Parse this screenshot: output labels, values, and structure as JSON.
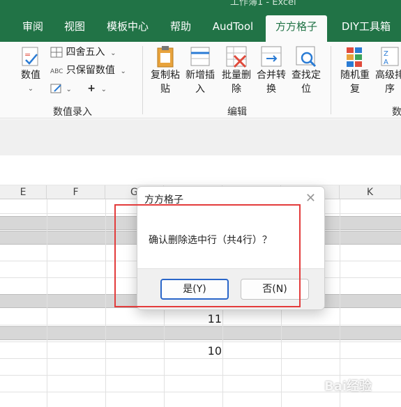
{
  "window": {
    "title": "工作簿1 - Excel"
  },
  "tabs": [
    {
      "label": "审阅",
      "active": false
    },
    {
      "label": "视图",
      "active": false
    },
    {
      "label": "模板中心",
      "active": false
    },
    {
      "label": "帮助",
      "active": false
    },
    {
      "label": "AudTool",
      "active": false
    },
    {
      "label": "方方格子",
      "active": true
    },
    {
      "label": "DIY工具箱",
      "active": false
    }
  ],
  "ribbon": {
    "numeric": {
      "value_btn": "数值",
      "round_label": "四舍五入",
      "keep_label": "只保留数值",
      "group_label": "数值录入"
    },
    "edit": {
      "copy_paste": "复制粘贴",
      "add_insert": "新增插入",
      "batch_delete": "批量删除",
      "merge_convert": "合并转换",
      "find_locate": "查找定位",
      "group_label": "编辑"
    },
    "more": {
      "random": "随机重复",
      "advanced": "高级排序",
      "group_label": "数"
    }
  },
  "columns": [
    "E",
    "F",
    "G",
    "K"
  ],
  "cells": {
    "value1": "11",
    "value2": "10"
  },
  "dialog": {
    "title": "方方格子",
    "message": "确认删除选中行（共4行）？",
    "yes_label": "是(Y)",
    "no_label": "否(N)"
  },
  "watermark": "Bai经验",
  "colors": {
    "accent": "#217346",
    "highlight_box": "#e33b3b",
    "primary_button_border": "#2a66c9"
  }
}
